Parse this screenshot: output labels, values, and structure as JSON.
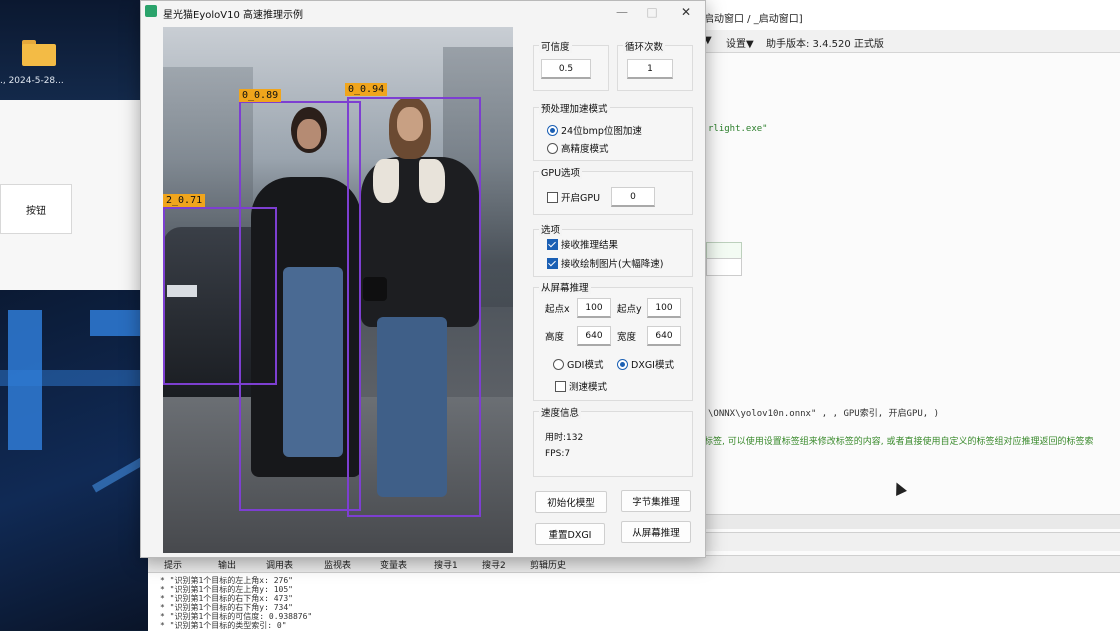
{
  "desktop": {
    "folder_date": "., 2024-5-28...",
    "left_button": "按钮"
  },
  "ide": {
    "title": "启动窗口 / _启动窗口]",
    "menu": [
      "▼",
      "设置▼",
      "助手版本: 3.4.520 正式版"
    ],
    "code_line_1": "rlight.exe\"",
    "code_line_2": "\\ONNX\\yolov10n.onnx\" , , GPU索引, 开启GPU, )",
    "code_line_3": "标签, 可以使用设置标签组来修改标签的内容, 或者直接使用自定义的标签组对应推理返回的标签索"
  },
  "bottom_tabs": [
    "提示",
    "输出",
    "调用表",
    "监视表",
    "变量表",
    "搜寻1",
    "搜寻2",
    "剪辑历史"
  ],
  "output_lines": [
    "* \"识别第1个目标的左上角x: 276\"",
    "* \"识别第1个目标的左上角y: 105\"",
    "* \"识别第1个目标的右下角x: 473\"",
    "* \"识别第1个目标的右下角y: 734\"",
    "* \"识别第1个目标的可信度: 0.938876\"",
    "* \"识别第1个目标的类型索引: 0\""
  ],
  "dialog": {
    "title": "星光猫EyoloV10 高速推理示例",
    "window_buttons": {
      "minimize": "—",
      "maximize": "□",
      "close": "✕"
    }
  },
  "detections": [
    {
      "label": "0_0.89"
    },
    {
      "label": "0_0.94"
    },
    {
      "label": "2_0.71"
    }
  ],
  "controls": {
    "confidence": {
      "label": "可信度",
      "value": "0.5"
    },
    "loop_count": {
      "label": "循环次数",
      "value": "1"
    },
    "preprocess": {
      "label": "预处理加速模式",
      "options": [
        "24位bmp位图加速",
        "高精度模式"
      ],
      "selected": "24位bmp位图加速"
    },
    "gpu": {
      "label": "GPU选项",
      "enable_label": "开启GPU",
      "enabled": false,
      "index_value": "0"
    },
    "options": {
      "label": "选项",
      "items": [
        {
          "text": "接收推理结果",
          "checked": true
        },
        {
          "text": "接收绘制图片(大幅降速)",
          "checked": true
        }
      ]
    },
    "screen": {
      "label": "从屏幕推理",
      "start_x_label": "起点x",
      "start_x": "100",
      "start_y_label": "起点y",
      "start_y": "100",
      "height_label": "高度",
      "height": "640",
      "width_label": "宽度",
      "width": "640",
      "modes": [
        "GDI模式",
        "DXGI模式"
      ],
      "selected_mode": "DXGI模式",
      "speedtest_label": "测速模式",
      "speedtest": false
    },
    "speed": {
      "label": "速度信息",
      "time": "用时:132",
      "fps": "FPS:7"
    },
    "buttons": {
      "init_model": "初始化模型",
      "byte_infer": "字节集推理",
      "reset_dxgi": "重置DXGI",
      "screen_infer": "从屏幕推理"
    }
  },
  "colors": {
    "detection_box": "#7d3fd1",
    "detection_label": "#f0a51c",
    "accent": "#1a5fb4"
  }
}
